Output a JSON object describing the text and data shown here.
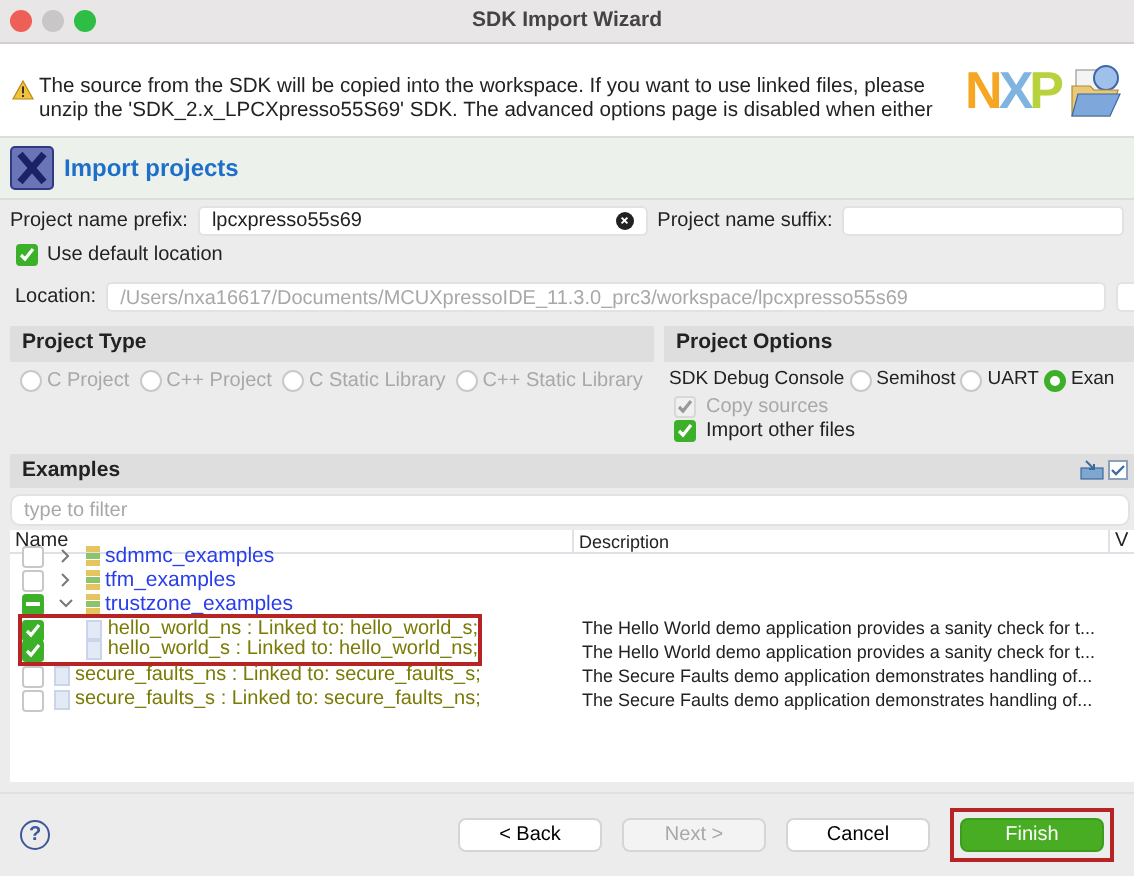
{
  "window": {
    "title": "SDK Import Wizard"
  },
  "banner": {
    "message": "The source from the SDK will be copied into the workspace. If you want to use linked files, please unzip the 'SDK_2.x_LPCXpresso55S69' SDK. The advanced options page is disabled when either",
    "logo": [
      "N",
      "X",
      "P"
    ]
  },
  "header": {
    "title": "Import projects"
  },
  "prefix": {
    "label": "Project name prefix:",
    "value": "lpcxpresso55s69"
  },
  "suffix": {
    "label": "Project name suffix:"
  },
  "default_location": {
    "label": "Use default location",
    "checked": true
  },
  "location": {
    "label": "Location:",
    "value": "/Users/nxa16617/Documents/MCUXpressoIDE_11.3.0_prc3/workspace/lpcxpresso55s69",
    "disabled": true
  },
  "project_type": {
    "title": "Project Type",
    "options": [
      {
        "label": "C Project",
        "selected": false
      },
      {
        "label": "C++ Project",
        "selected": false
      },
      {
        "label": "C Static Library",
        "selected": false
      },
      {
        "label": "C++ Static Library",
        "selected": false
      }
    ]
  },
  "project_options": {
    "title": "Project Options",
    "console_label": "SDK Debug Console",
    "console_options": [
      {
        "label": "Semihost",
        "selected": false
      },
      {
        "label": "UART",
        "selected": false
      },
      {
        "label": "Exan",
        "selected": true
      }
    ],
    "checks": [
      {
        "label": "Copy sources",
        "checked": true,
        "disabled": true
      },
      {
        "label": "Import other files",
        "checked": true,
        "disabled": false
      }
    ]
  },
  "examples": {
    "title": "Examples",
    "filter_placeholder": "type to filter",
    "columns": [
      "Name",
      "Description",
      "V"
    ],
    "rows": [
      {
        "name": "sdmmc_examples",
        "partial": false,
        "expanded": false,
        "children": []
      },
      {
        "name": "tfm_examples",
        "partial": false,
        "expanded": false,
        "children": []
      },
      {
        "name": "trustzone_examples",
        "partial": true,
        "expanded": true,
        "children": [
          {
            "name": "hello_world_ns : Linked to: hello_world_s;",
            "description": "The Hello World demo application provides a sanity check for t...",
            "checked": true,
            "highlighted": true
          },
          {
            "name": "hello_world_s : Linked to: hello_world_ns;",
            "description": "The Hello World demo application provides a sanity check for t...",
            "checked": true,
            "highlighted": true
          },
          {
            "name": "secure_faults_ns : Linked to: secure_faults_s;",
            "description": "The Secure Faults demo application demonstrates handling of...",
            "checked": false,
            "highlighted": false
          },
          {
            "name": "secure_faults_s : Linked to: secure_faults_ns;",
            "description": "The Secure Faults demo application demonstrates handling of...",
            "checked": false,
            "highlighted": false
          }
        ]
      }
    ]
  },
  "footer": {
    "help": "?",
    "buttons": [
      {
        "label": "< Back",
        "kind": "normal",
        "disabled": false,
        "highlighted": false
      },
      {
        "label": "Next >",
        "kind": "normal",
        "disabled": true,
        "highlighted": false
      },
      {
        "label": "Cancel",
        "kind": "normal",
        "disabled": false,
        "highlighted": false
      },
      {
        "label": "Finish",
        "kind": "primary",
        "disabled": false,
        "highlighted": true
      }
    ]
  }
}
